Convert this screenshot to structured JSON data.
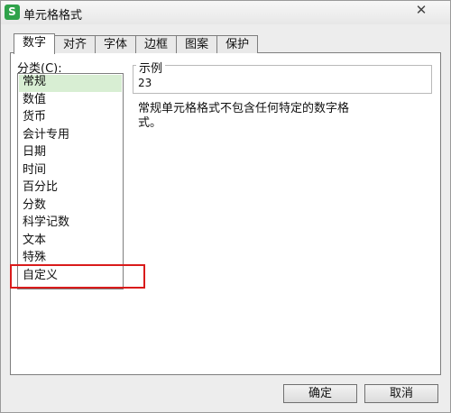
{
  "window": {
    "title": "单元格格式",
    "app_icon_letter": "S"
  },
  "tabs": [
    "数字",
    "对齐",
    "字体",
    "边框",
    "图案",
    "保护"
  ],
  "category": {
    "label": "分类(C):",
    "items": [
      "常规",
      "数值",
      "货币",
      "会计专用",
      "日期",
      "时间",
      "百分比",
      "分数",
      "科学记数",
      "文本",
      "特殊",
      "自定义"
    ],
    "selected": "常规",
    "highlighted": "自定义"
  },
  "sample": {
    "label": "示例",
    "value": "23"
  },
  "description": "常规单元格格式不包含任何特定的数字格式。",
  "buttons": {
    "ok": "确定",
    "cancel": "取消"
  },
  "colors": {
    "selected_bg": "#d8eed3",
    "highlight_border": "#d91b1b",
    "app_icon": "#2fa24a"
  }
}
